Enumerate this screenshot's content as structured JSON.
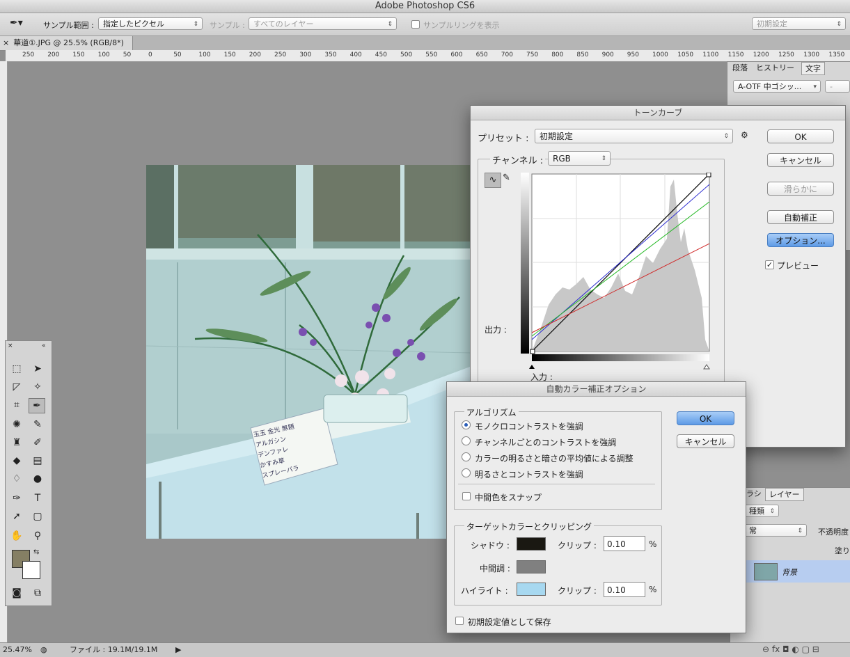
{
  "app": {
    "title": "Adobe Photoshop CS6"
  },
  "options_bar": {
    "sample_size_label": "サンプル範囲 :",
    "sample_size_value": "指定したピクセル",
    "sample_label": "サンプル :",
    "sample_value": "すべてのレイヤー",
    "show_ring_label": "サンプルリングを表示",
    "workspace_value": "初期設定"
  },
  "document_tab": {
    "label": "華道①.JPG @ 25.5% (RGB/8*)"
  },
  "ruler_labels": [
    "250",
    "200",
    "150",
    "100",
    "50",
    "0",
    "50",
    "100",
    "150",
    "200",
    "250",
    "300",
    "350",
    "400",
    "450",
    "500",
    "550",
    "600",
    "650",
    "700",
    "750",
    "800",
    "850",
    "900",
    "950",
    "1000",
    "1050",
    "1100",
    "1150",
    "1200",
    "1250",
    "1300",
    "1350"
  ],
  "right_panel": {
    "tabs": [
      "段落",
      "ヒストリー",
      "文字"
    ],
    "font_value": "A-OTF 中ゴシッ...",
    "font_style": "-",
    "bottom_tabs": [
      "ラシ",
      "レイヤー"
    ],
    "kind_label": "種類",
    "opacity_label": "不透明度",
    "blend_label": "常",
    "fill_label": "塗り",
    "layer_name": "背景"
  },
  "curves_dialog": {
    "title": "トーンカーブ",
    "preset_label": "プリセット :",
    "preset_value": "初期設定",
    "channel_label": "チャンネル :",
    "channel_value": "RGB",
    "output_label": "出力 :",
    "input_label": "入力 :",
    "ok_label": "OK",
    "cancel_label": "キャンセル",
    "smooth_label": "滑らかに",
    "auto_label": "自動補正",
    "options_label": "オプション...",
    "preview_label": "プレビュー",
    "preview_checked": true
  },
  "auto_color_dialog": {
    "title": "自動カラー補正オプション",
    "algorithms_title": "アルゴリズム",
    "algorithms": [
      {
        "label": "モノクロコントラストを強調",
        "selected": true
      },
      {
        "label": "チャンネルごとのコントラストを強調",
        "selected": false
      },
      {
        "label": "カラーの明るさと暗さの平均値による調整",
        "selected": false
      },
      {
        "label": "明るさとコントラストを強調",
        "selected": false
      }
    ],
    "snap_label": "中間色をスナップ",
    "targets_title": "ターゲットカラーとクリッピング",
    "shadow_label": "シャドウ :",
    "shadow_clip_label": "クリップ :",
    "shadow_clip_value": "0.10",
    "midtone_label": "中間調 :",
    "highlight_label": "ハイライト :",
    "highlight_clip_label": "クリップ :",
    "highlight_clip_value": "0.10",
    "percent": "%",
    "save_default_label": "初期設定値として保存",
    "ok_label": "OK",
    "cancel_label": "キャンセル",
    "colors": {
      "shadow": "#1a1812",
      "midtone": "#808080",
      "highlight": "#a7d8f0"
    }
  },
  "status_bar": {
    "zoom": "25.47%",
    "file_info": "ファイル : 19.1M/19.1M"
  },
  "colors": {
    "foreground": "#857f64",
    "background": "#ffffff",
    "accent": "#5d9ae6"
  },
  "card_text": [
    "玉玉 金光 無題",
    "アルガシン",
    "デンファレ",
    "かすみ草",
    "スプレーバラ"
  ]
}
